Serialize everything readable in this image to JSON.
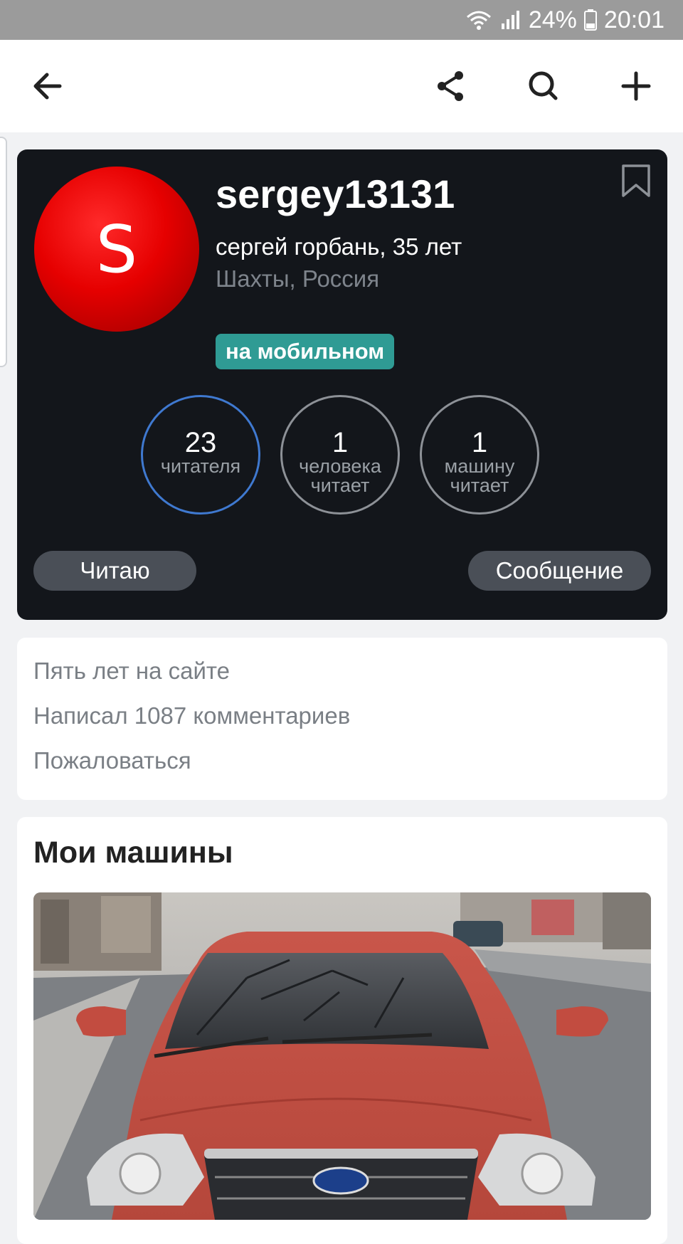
{
  "status_bar": {
    "battery_percent": "24%",
    "time": "20:01",
    "icons": [
      "wifi-icon",
      "signal-icon",
      "battery-icon"
    ]
  },
  "app_bar": {
    "icons": [
      "back-arrow-icon",
      "share-icon",
      "search-icon",
      "plus-icon"
    ]
  },
  "profile": {
    "username": "sergey13131",
    "full_name": "сергей горбань, 35 лет",
    "location": "Шахты, Россия",
    "badge": "на мобильном",
    "avatar_letter": "S",
    "avatar_color": "#e60000",
    "bookmark_icon": "bookmark-icon",
    "stats": [
      {
        "number": "23",
        "label": "читателя"
      },
      {
        "number": "1",
        "label": "человека\nчитает"
      },
      {
        "number": "1",
        "label": "машину\nчитает"
      }
    ],
    "follow_button": "Читаю",
    "message_button": "Сообщение"
  },
  "info": {
    "lines": [
      "Пять лет на сайте",
      "Написал 1087 комментариев",
      "Пожаловаться"
    ]
  },
  "cars": {
    "title": "Мои машины"
  },
  "colors": {
    "badge": "#2f9b94",
    "card_dark": "#13161b",
    "readers_ring": "#3f79d0"
  }
}
